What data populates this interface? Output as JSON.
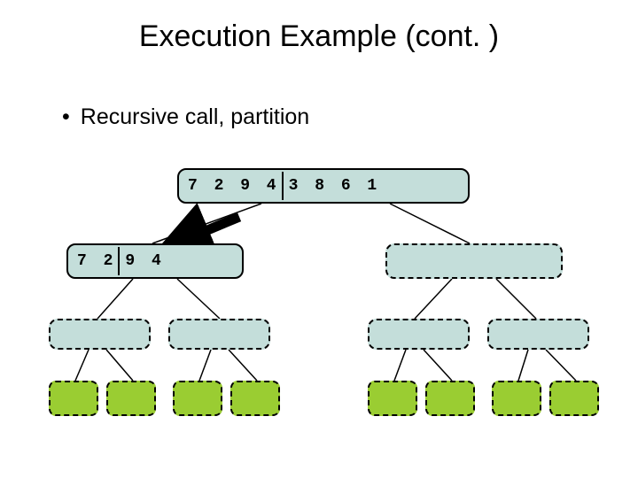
{
  "title": "Execution Example (cont. )",
  "bullet": "Recursive call, partition",
  "root": {
    "left": "7 2 9 4",
    "right": "3 8 6 1"
  },
  "level2_left": {
    "left": "7 2",
    "right": "9 4"
  }
}
